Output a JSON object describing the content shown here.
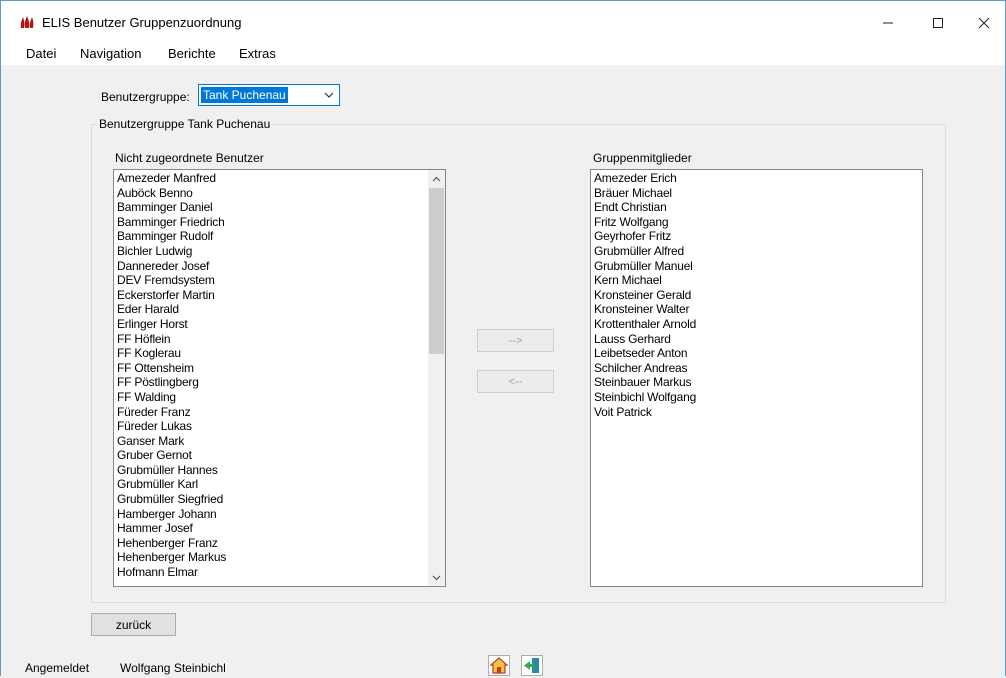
{
  "window": {
    "title": "ELIS Benutzer Gruppenzuordnung",
    "icon": "elis-flame-logo",
    "controls": [
      "minimize-icon",
      "maximize-icon",
      "close-icon"
    ]
  },
  "menu": {
    "items": [
      "Datei",
      "Navigation",
      "Berichte",
      "Extras"
    ]
  },
  "form": {
    "group_label": "Benutzergruppe:",
    "group_selected": "Tank Puchenau",
    "groupbox_title": "Benutzergruppe Tank Puchenau",
    "left_list_label": "Nicht zugeordnete Benutzer",
    "right_list_label": "Gruppenmitglieder",
    "add_button": "-->",
    "remove_button": "<--",
    "back_button": "zurück"
  },
  "left_list": [
    "Amezeder Manfred",
    "Auböck Benno",
    "Bamminger Daniel",
    "Bamminger Friedrich",
    "Bamminger Rudolf",
    "Bichler Ludwig",
    "Dannereder Josef",
    "DEV Fremdsystem",
    "Eckerstorfer Martin",
    "Eder Harald",
    "Erlinger Horst",
    "FF Höflein",
    "FF Koglerau",
    "FF Ottensheim",
    "FF Pöstlingberg",
    "FF Walding",
    "Füreder Franz",
    "Füreder Lukas",
    "Ganser Mark",
    "Gruber Gernot",
    "Grubmüller Hannes",
    "Grubmüller Karl",
    "Grubmüller Siegfried",
    "Hamberger Johann",
    "Hammer Josef",
    "Hehenberger Franz",
    "Hehenberger Markus",
    "Hofmann Elmar"
  ],
  "right_list": [
    "Amezeder Erich",
    "Bräuer Michael",
    "Endt Christian",
    "Fritz Wolfgang",
    "Geyrhofer Fritz",
    "Grubmüller Alfred",
    "Grubmüller Manuel",
    "Kern Michael",
    "Kronsteiner Gerald",
    "Kronsteiner Walter",
    "Krottenthaler Arnold",
    "Lauss Gerhard",
    "Leibetseder Anton",
    "Schilcher Andreas",
    "Steinbauer Markus",
    "Steinbichl Wolfgang",
    "Voit Patrick"
  ],
  "status": {
    "logged_in_label": "Angemeldet",
    "user_name": "Wolfgang Steinbichl",
    "icons": [
      "home-icon",
      "exit-door-icon"
    ]
  },
  "colors": {
    "selection": "#0078d7",
    "window_border": "#5b9bd5",
    "background": "#f0f0f0"
  }
}
